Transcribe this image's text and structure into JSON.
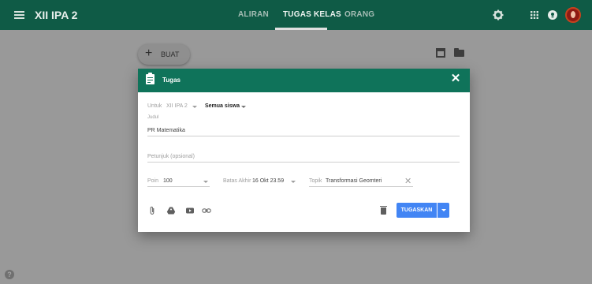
{
  "topbar": {
    "class_name": "XII IPA 2",
    "tabs": [
      {
        "label": "ALIRAN",
        "active": false
      },
      {
        "label": "TUGAS KELAS",
        "active": true
      },
      {
        "label": "ORANG",
        "active": false
      }
    ]
  },
  "classwork": {
    "create_label": "BUAT"
  },
  "dialog": {
    "title": "Tugas",
    "for_label": "Untuk",
    "class_value": "XII IPA 2",
    "students_value": "Semua siswa",
    "title_label": "Judul",
    "title_value": "PR Matematika",
    "instructions_placeholder": "Petunjuk (opsional)",
    "points_label": "Poin",
    "points_value": "100",
    "due_label": "Batas Akhir",
    "due_value": "16 Okt 23.59",
    "topic_label": "Topik",
    "topic_value": "Transformasi Geomteri",
    "assign_label": "TUGASKAN"
  },
  "colors": {
    "header": "#0f5b46",
    "dialog_header": "#0f735a",
    "assign_button": "#4285f4",
    "overlay": "#999999"
  }
}
